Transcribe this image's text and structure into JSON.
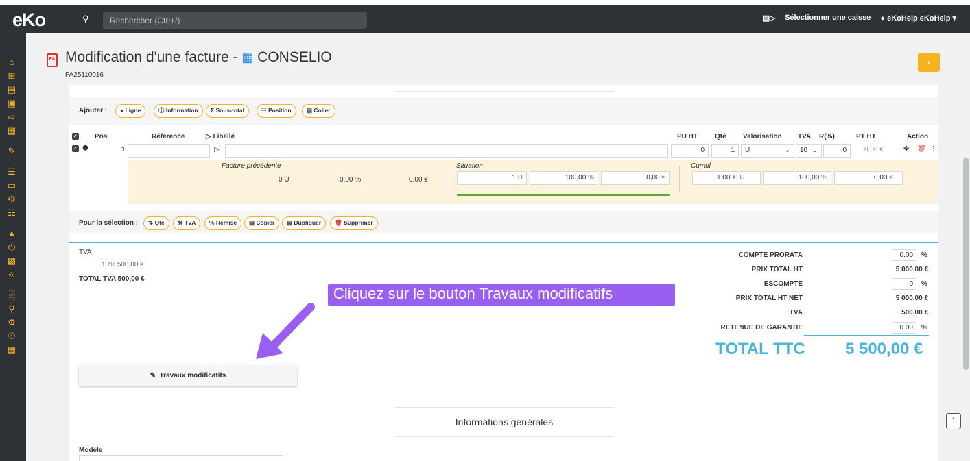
{
  "app": {
    "logo": "eKo",
    "search_placeholder": "Rechercher (Ctrl+/)",
    "select_register": "Sélectionner une caisse",
    "user": "eKoHelp eKoHelp"
  },
  "header": {
    "title": "Modification d'une facture - ",
    "client": "CONSELIO",
    "reference": "FA25110016",
    "next": "›"
  },
  "toolbar": {
    "label": "Ajouter :",
    "buttons": [
      "Ligne",
      "Information",
      "Sous-total",
      "Position",
      "Coller"
    ]
  },
  "table": {
    "headers": {
      "pos": "Pos.",
      "reference": "Référence",
      "libelle": "Libellé",
      "pu_ht": "PU HT",
      "qte": "Qté",
      "valorisation": "Valorisation",
      "tva": "TVA",
      "remise": "R(%)",
      "pt_ht": "PT HT",
      "action": "Action"
    },
    "row": {
      "pos": "1",
      "reference": "",
      "libelle": "",
      "pu_ht": "0",
      "qte": "1",
      "unit": "U",
      "tva": "10",
      "remise": "0",
      "pt_ht": "0,00 €"
    },
    "situation": {
      "prev_label": "Facture précédente",
      "prev_qty": "0 U",
      "prev_pct": "0,00 %",
      "prev_amount": "0,00 €",
      "sit_label": "Situation",
      "sit_qty": "1",
      "sit_unit": "U",
      "sit_pct": "100,00",
      "sit_pct_sym": "%",
      "sit_amount": "0,00",
      "sit_cur": "€",
      "cum_label": "Cumul",
      "cum_qty": "1.0000",
      "cum_unit": "U",
      "cum_pct": "100,00",
      "cum_pct_sym": "%",
      "cum_amount": "0,00",
      "cum_cur": "€"
    }
  },
  "selection": {
    "label": "Pour la sélection :",
    "buttons": [
      "Qté",
      "TVA",
      "Remise",
      "Copier",
      "Dupliquer",
      "Supprimer"
    ]
  },
  "tva": {
    "title": "TVA",
    "line": "10% 500,00 €",
    "total": "TOTAL TVA 500,00 €"
  },
  "totals": {
    "compte_prorata_label": "COMPTE PRORATA",
    "compte_prorata": "0.00",
    "pct": "%",
    "prix_total_ht_label": "PRIX TOTAL HT",
    "prix_total_ht": "5 000,00 €",
    "escompte_label": "ESCOMPTE",
    "escompte": "0",
    "prix_total_ht_net_label": "PRIX TOTAL HT NET",
    "prix_total_ht_net": "5 000,00 €",
    "tva_label": "TVA",
    "tva": "500,00 €",
    "retenue_label": "RETENUE DE GARANTIE",
    "retenue": "0.00",
    "ttc_label": "TOTAL TTC",
    "ttc": "5 500,00 €"
  },
  "callout": "Cliquez sur le bouton Travaux modificatifs",
  "travaux_button": "Travaux modificatifs",
  "section_title": "Informations générales",
  "modele_label": "Modèle",
  "colors": {
    "accent": "#f5b320",
    "teal": "#4ab7d9",
    "callout": "#9a5ef0",
    "danger": "#d9342b"
  }
}
